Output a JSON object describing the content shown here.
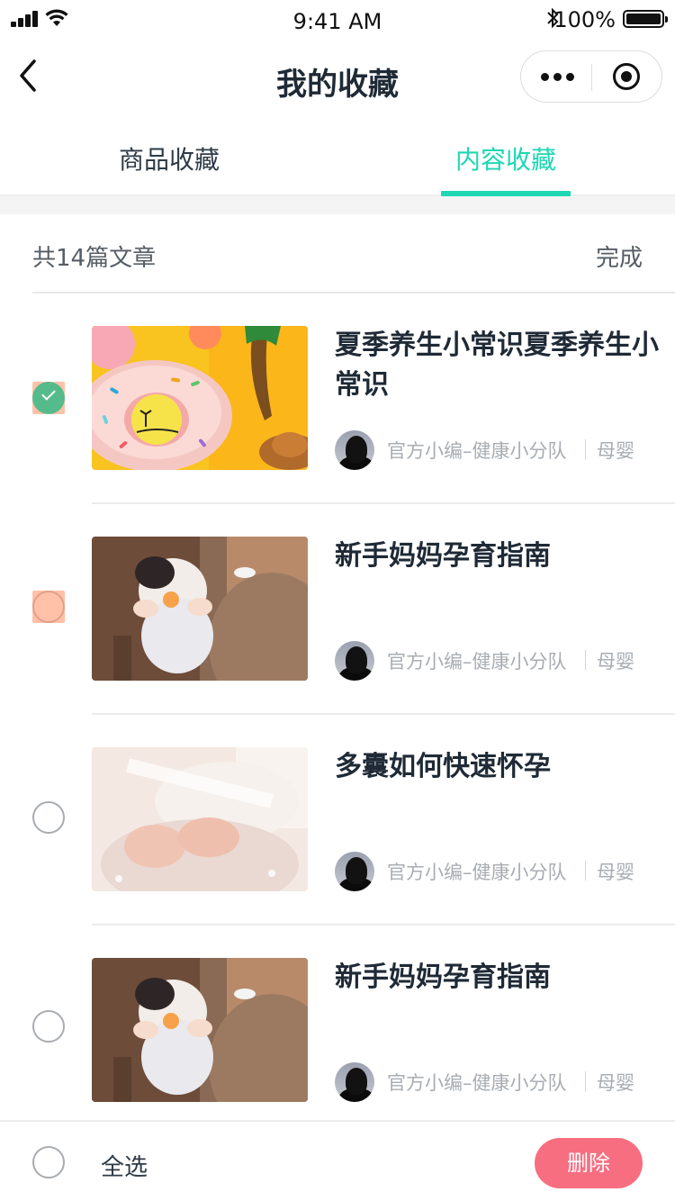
{
  "status_bar": {
    "time": "9:41 AM",
    "battery": "100%"
  },
  "nav": {
    "title": "我的收藏"
  },
  "tabs": [
    {
      "label": "商品收藏",
      "active": false
    },
    {
      "label": "内容收藏",
      "active": true
    }
  ],
  "summary": {
    "count_text": "共14篇文章",
    "done_label": "完成"
  },
  "articles": [
    {
      "title": "夏季养生小常识夏季养生小常识",
      "author": "官方小编–健康小分队",
      "category": "母婴",
      "selected": true,
      "thumbnail": "donut-float-icon"
    },
    {
      "title": "新手妈妈孕育指南",
      "author": "官方小编–健康小分队",
      "category": "母婴",
      "selected": false,
      "thumbnail": "baby-eating-photo"
    },
    {
      "title": "多囊如何快速怀孕",
      "author": "官方小编–健康小分队",
      "category": "母婴",
      "selected": false,
      "thumbnail": "baby-hands-photo"
    },
    {
      "title": "新手妈妈孕育指南",
      "author": "官方小编–健康小分队",
      "category": "母婴",
      "selected": false,
      "thumbnail": "baby-eating-photo"
    }
  ],
  "bottom_bar": {
    "select_all_label": "全选",
    "delete_label": "删除"
  },
  "colors": {
    "accent": "#1ed7b3",
    "delete": "#f76e80",
    "check_green": "#55bb8a",
    "placeholder_peach": "#ffc1a8"
  }
}
